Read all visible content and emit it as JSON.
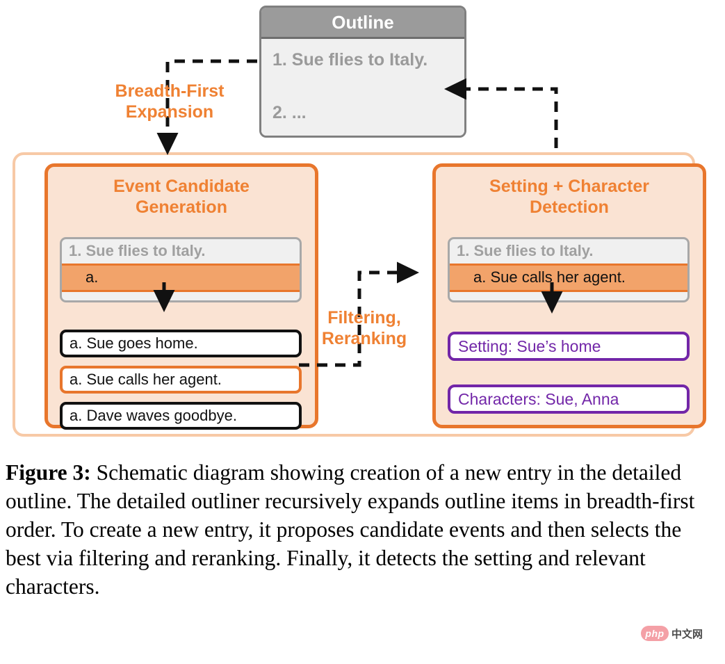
{
  "outline_card": {
    "title": "Outline",
    "items": [
      "1. Sue flies to Italy.",
      "2. ..."
    ]
  },
  "edge_labels": {
    "breadth_first": "Breadth-First\nExpansion",
    "filtering": "Filtering,\nReranking"
  },
  "stages": [
    {
      "id": "generation",
      "title": "Event Candidate\nGeneration",
      "mini_outline": {
        "parent_item": "1. Sue flies to Italy.",
        "highlight_item": "a."
      },
      "candidates": [
        {
          "text": "a. Sue goes home.",
          "selected": false
        },
        {
          "text": "a. Sue calls her agent.",
          "selected": true
        },
        {
          "text": "a. Dave waves goodbye.",
          "selected": false
        }
      ]
    },
    {
      "id": "detection",
      "title": "Setting + Character\nDetection",
      "mini_outline": {
        "parent_item": "1. Sue flies to Italy.",
        "highlight_item": "a. Sue calls her agent."
      },
      "attributes": [
        "Setting: Sue’s home",
        "Characters: Sue, Anna"
      ]
    }
  ],
  "caption": {
    "label": "Figure 3:",
    "text": " Schematic diagram showing creation of a new entry in the detailed outline. The detailed outliner recursively expands outline items in breadth-first order. To create a new entry, it proposes candidate events and then selects the best via filtering and reranking. Finally, it detects the setting and relevant characters."
  },
  "watermark": {
    "badge": "php",
    "text": "中文网"
  },
  "colors": {
    "orange_accent": "#e8762c",
    "orange_title": "#ef8133",
    "orange_panel_bg": "#fae3d3",
    "orange_wrapper_border": "#f7c9a6",
    "highlight_row_bg": "#f2a36a",
    "purple": "#7226a8",
    "gray_header": "#9b9b9b",
    "gray_text": "#9a9a9a",
    "mini_outline_bg": "#f0f0f0"
  }
}
